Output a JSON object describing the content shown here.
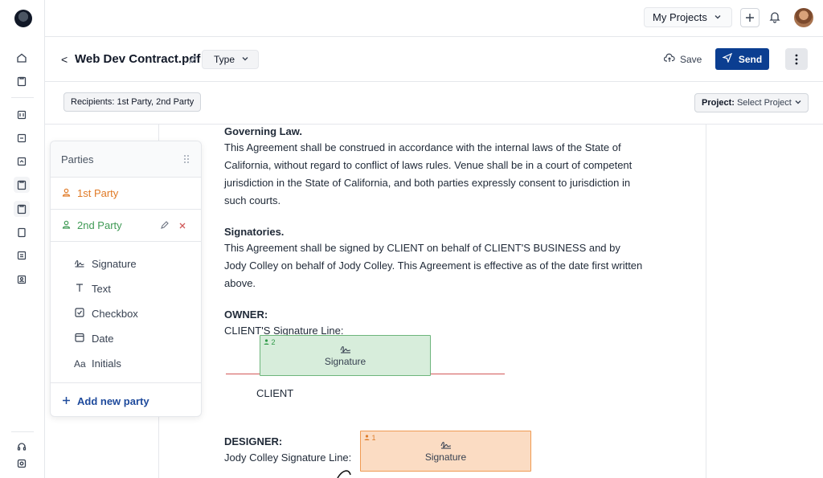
{
  "topbar": {
    "projects_label": "My Projects"
  },
  "header": {
    "back_label": "<",
    "doc_title": "Web Dev Contract.pdf",
    "type_label": "Type",
    "save_label": "Save",
    "send_label": "Send"
  },
  "subbar": {
    "recipients_label": "Recipients: 1st Party, 2nd Party",
    "project_prefix": "Project:",
    "project_value": "Select Project"
  },
  "parties": {
    "title": "Parties",
    "list": [
      {
        "name": "1st Party",
        "color": "#e07a26"
      },
      {
        "name": "2nd Party",
        "color": "#3f9a55"
      }
    ],
    "fields": [
      {
        "label": "Signature",
        "icon": "signature-icon"
      },
      {
        "label": "Text",
        "icon": "text-icon"
      },
      {
        "label": "Checkbox",
        "icon": "checkbox-icon"
      },
      {
        "label": "Date",
        "icon": "calendar-icon"
      },
      {
        "label": "Initials",
        "icon": "initials-icon"
      }
    ],
    "add_label": "Add new party"
  },
  "document": {
    "governing_title": "Governing Law.",
    "governing_body": "This Agreement shall be construed in accordance with the internal laws of the State of California, without regard to conflict of laws rules. Venue shall be in a court of competent jurisdiction in the State of California, and both parties expressly consent to jurisdiction in such courts.",
    "signatories_title": "Signatories.",
    "signatories_body": "This Agreement shall be signed by CLIENT on behalf of CLIENT'S BUSINESS and by Jody Colley on behalf of Jody Colley. This Agreement is effective as of the date first written above.",
    "owner_title": "OWNER:",
    "owner_line": "CLIENT'S Signature Line:",
    "client_label": "CLIENT",
    "designer_title": "DESIGNER:",
    "designer_line": "Jody Colley Signature Line:"
  },
  "signature_boxes": [
    {
      "party_tag": "2",
      "label": "Signature",
      "color": "#3f9a55"
    },
    {
      "party_tag": "1",
      "label": "Signature",
      "color": "#e07a26"
    }
  ]
}
